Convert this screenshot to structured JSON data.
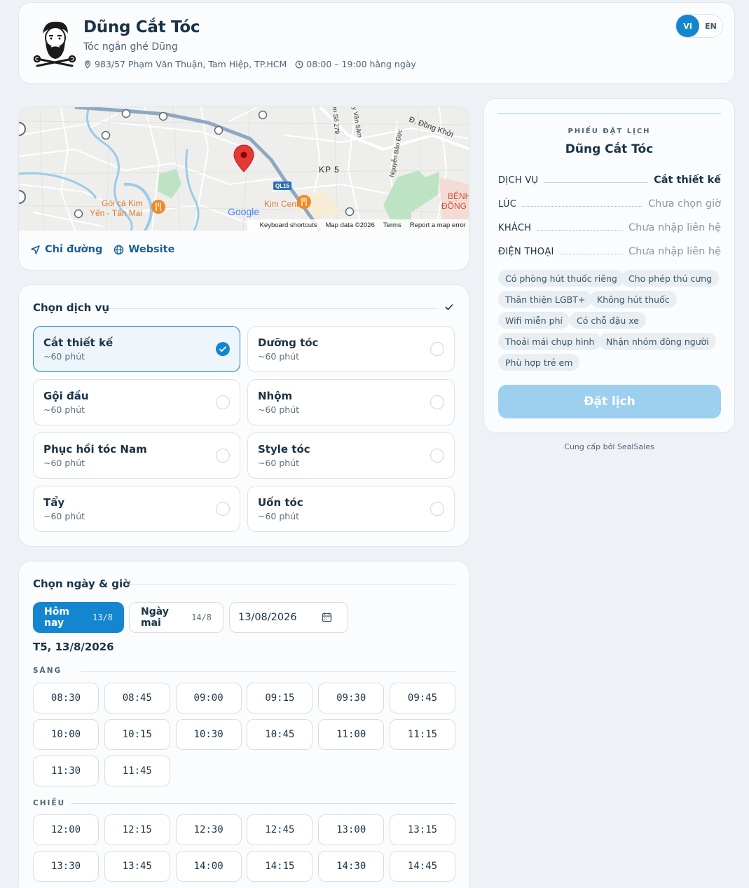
{
  "shop": {
    "name": "Dũng Cắt Tóc",
    "tagline": "Tóc ngắn ghé Dũng",
    "address": "983/57 Phạm Văn Thuận, Tam Hiệp, TP.HCM",
    "hours": "08:00 – 19:00 hằng ngày"
  },
  "lang": {
    "vi": "VI",
    "en": "EN",
    "active": "VI"
  },
  "map": {
    "labels": {
      "road_dong_khoi": "Đ. Đồng Khởi",
      "kp5": "KP 5",
      "ql15": "QL15",
      "kim_center": "Kim Center",
      "goi_ca_1": "Gỏi cá Kim",
      "goi_ca_2": "Yến - Tân Mai",
      "benh_1": "BỆNH",
      "benh_2": "ĐỒNG",
      "nguyen_bao_duc": "Nguyễn Bảo Đức",
      "so279": "m Số 279",
      "van_sam": "y Văn Sâm",
      "google": "Google"
    },
    "footer": {
      "shortcuts": "Keyboard shortcuts",
      "data": "Map data ©2026",
      "terms": "Terms",
      "report": "Report a map error"
    }
  },
  "links": {
    "directions": "Chỉ đường",
    "website": "Website"
  },
  "services": {
    "title": "Chọn dịch vụ",
    "items": [
      {
        "name": "Cắt thiết kế",
        "duration": "~60 phút",
        "selected": true
      },
      {
        "name": "Dưỡng tóc",
        "duration": "~60 phút",
        "selected": false
      },
      {
        "name": "Gội đầu",
        "duration": "~60 phút",
        "selected": false
      },
      {
        "name": "Nhộm",
        "duration": "~60 phút",
        "selected": false
      },
      {
        "name": "Phục hồi tóc Nam",
        "duration": "~60 phút",
        "selected": false
      },
      {
        "name": "Style tóc",
        "duration": "~60 phút",
        "selected": false
      },
      {
        "name": "Tẩy",
        "duration": "~60 phút",
        "selected": false
      },
      {
        "name": "Uốn tóc",
        "duration": "~60 phút",
        "selected": false
      }
    ]
  },
  "schedule": {
    "title": "Chọn ngày & giờ",
    "today": {
      "label": "Hôm nay",
      "date": "13/8"
    },
    "tomorrow": {
      "label": "Ngày mai",
      "date": "14/8"
    },
    "date_value": "13/08/2026",
    "selected_day": "T5, 13/8/2026",
    "morning": {
      "label": "SÁNG",
      "slots": [
        "08:30",
        "08:45",
        "09:00",
        "09:15",
        "09:30",
        "09:45",
        "10:00",
        "10:15",
        "10:30",
        "10:45",
        "11:00",
        "11:15",
        "11:30",
        "11:45"
      ]
    },
    "afternoon": {
      "label": "CHIỀU",
      "slots": [
        "12:00",
        "12:15",
        "12:30",
        "12:45",
        "13:00",
        "13:15",
        "13:30",
        "13:45",
        "14:00",
        "14:15",
        "14:30",
        "14:45"
      ]
    }
  },
  "ticket": {
    "eyebrow": "PHIẾU ĐẶT LỊCH",
    "title": "Dũng Cắt Tóc",
    "rows": [
      {
        "key": "DỊCH VỤ",
        "value": "Cắt thiết kế"
      },
      {
        "key": "LÚC",
        "value": "Chưa chọn giờ"
      },
      {
        "key": "KHÁCH",
        "value": "Chưa nhập liên hệ"
      },
      {
        "key": "ĐIỆN THOẠI",
        "value": "Chưa nhập liên hệ"
      }
    ],
    "amenities": [
      "Có phòng hút thuốc riêng",
      "Cho phép thú cưng",
      "Thân thiện LGBT+",
      "Không hút thuốc",
      "Wifi miễn phí",
      "Có chỗ đậu xe",
      "Thoải mái chụp hình",
      "Nhận nhóm đông người",
      "Phù hợp trẻ em"
    ],
    "book_label": "Đặt lịch"
  },
  "powered_by": "Cung cấp bởi SealSales",
  "colors": {
    "accent": "#1486d0",
    "book_disabled": "#9dd0ee",
    "bg": "#eef2f6"
  }
}
